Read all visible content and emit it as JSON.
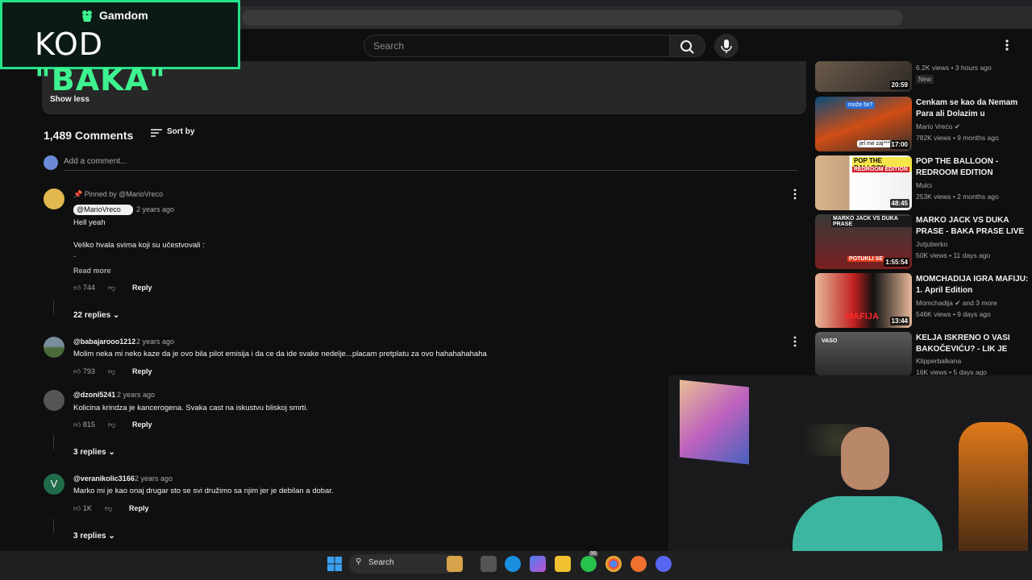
{
  "overlay": {
    "brand": "Gamdom",
    "code_prefix": "KOD ",
    "code_value": "\"BAKA\""
  },
  "header": {
    "search_placeholder": "Search"
  },
  "description": {
    "show_less": "Show less"
  },
  "comments": {
    "count_label": "1,489 Comments",
    "sort_label": "Sort by",
    "add_placeholder": "Add a comment...",
    "items": [
      {
        "pinned_label": "Pinned by @MarioVreco",
        "author": "@MarioVreco",
        "time": "2 years ago",
        "lines": [
          "Hell yeah",
          "Veliko hvala svima koji su učestvovali :",
          "-"
        ],
        "read_more": "Read more",
        "likes": "744",
        "reply": "Reply",
        "replies": "22 replies"
      },
      {
        "author": "@babajarooo1212",
        "time": "2 years ago",
        "text": "Molim neka mi neko kaze da je ovo bila pilot emisija i da ce da ide svake nedelje...placam pretplatu za ovo hahahahahaha",
        "likes": "793",
        "reply": "Reply"
      },
      {
        "author": "@dzoni5241",
        "time": "2 years ago",
        "text": "Kolicina krindza je kancerogena. Svaka cast na iskustvu bliskoj smrti.",
        "likes": "815",
        "reply": "Reply",
        "replies": "3 replies"
      },
      {
        "avatar_letter": "V",
        "author": "@veranikolic3166",
        "time": "2 years ago",
        "text": "Marko mi je kao onaj drugar sto se svi družimo sa njim jer je debilan a dobar.",
        "likes": "1K",
        "reply": "Reply",
        "replies": "3 replies"
      }
    ]
  },
  "sidebar": {
    "videos": [
      {
        "title": "",
        "channel": "",
        "meta": "6.2K views • 3 hours ago",
        "badge": "New",
        "duration": "20:59"
      },
      {
        "title": "Cenkam se kao da Nemam Para ali Dolazim u Lamborghiniju",
        "channel": "Mario Vrećo",
        "meta": "782K views • 9 months ago",
        "duration": "17:00",
        "thumb_text_1": "može še?",
        "thumb_text_2": "jel me zaj***"
      },
      {
        "title": "POP THE BALLOON - REDROOM EDITION",
        "channel": "Mulci",
        "meta": "253K views • 2 months ago",
        "duration": "48:45",
        "thumb_text_1": "POP THE BALLOON",
        "thumb_text_2": "REDROOM EDITION"
      },
      {
        "title": "MARKO JACK VS DUKA PRASE - BAKA PRASE LIVE *potukli se*",
        "channel": "Jutjuberko",
        "meta": "50K views • 11 days ago",
        "duration": "1:55:54",
        "thumb_text_1": "MARKO JACK VS DUKA PRASE",
        "thumb_text_2": "POTUKLI SE"
      },
      {
        "title": "MOMCHADIJA IGRA MAFIJU: 1. April Edition",
        "channel": "Momchadija",
        "channel_extra": "and 3 more",
        "meta": "546K views • 9 days ago",
        "duration": "13:44",
        "thumb_text_1": "MAFIJA"
      },
      {
        "title": "KELJA ISKRENO O VASI BAKOČEVIĆU? - LIK JE DEBIL!...",
        "channel": "Klipperbalkana",
        "meta": "16K views • 5 days ago",
        "thumb_text_1": "VASO"
      }
    ]
  },
  "taskbar": {
    "search_label": "Search",
    "badge": "99"
  },
  "colors": {
    "accent": "#3ef38f",
    "background": "#0f0f0f"
  }
}
